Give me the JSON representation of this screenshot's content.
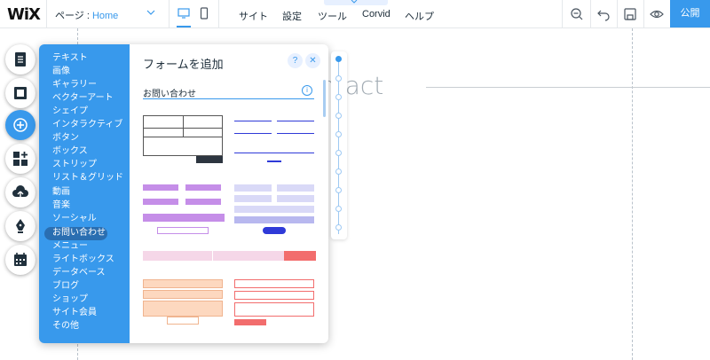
{
  "topbar": {
    "logo": "WiX",
    "page_label": "ページ : ",
    "page_value": "Home",
    "menu": [
      "サイト",
      "設定",
      "ツール",
      "Corvid",
      "ヘルプ"
    ],
    "publish": "公開"
  },
  "canvas": {
    "bg_text": "ntact"
  },
  "add_panel": {
    "title": "フォームを追加",
    "help": "?",
    "close": "✕",
    "section_title": "お問い合わせ",
    "info": "i",
    "categories": [
      "テキスト",
      "画像",
      "ギャラリー",
      "ベクターアート",
      "シェイプ",
      "インタラクティブ",
      "ボタン",
      "ボックス",
      "ストリップ",
      "リスト＆グリッド",
      "動画",
      "音楽",
      "ソーシャル",
      "お問い合わせ",
      "メニュー",
      "ライトボックス",
      "データベース",
      "ブログ",
      "ショップ",
      "サイト会員",
      "その他"
    ],
    "selected_category": "お問い合わせ"
  },
  "colors": {
    "accent": "#3899ec",
    "selected_category_bg": "#2a6eb1",
    "purple": "#c58ee8",
    "lavender": "#d9d9f7",
    "coral": "#f26d6d",
    "peach": "#fdd8bf"
  }
}
